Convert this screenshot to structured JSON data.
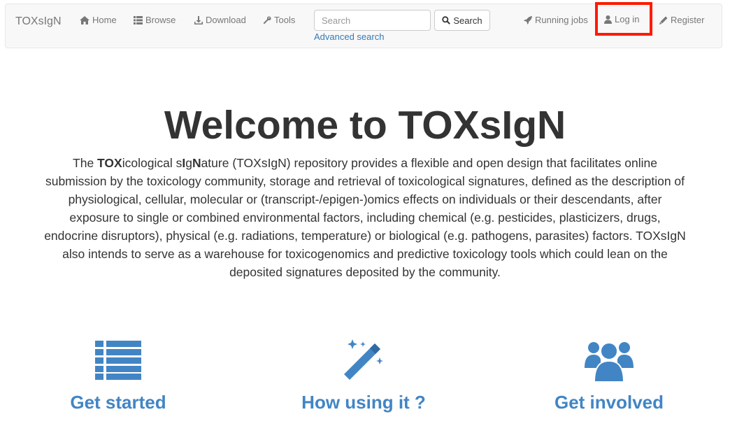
{
  "navbar": {
    "brand": "TOXsIgN",
    "home": "Home",
    "browse": "Browse",
    "download": "Download",
    "tools": "Tools",
    "search_placeholder": "Search",
    "search_button": "Search",
    "advanced_search": "Advanced search",
    "running_jobs": "Running jobs",
    "login": "Log in",
    "register": "Register",
    "highlight_color": "#ff1a00"
  },
  "hero": {
    "title": "Welcome to TOXsIgN",
    "desc_p1": "The ",
    "desc_b1": "TOX",
    "desc_p2": "icological s",
    "desc_b2": "I",
    "desc_p3": "g",
    "desc_b3": "N",
    "desc_p4": "ature (TOXsIgN) repository provides a flexible and open design that facilitates online submission by the toxicology community, storage and retrieval of toxicological signatures, defined as the description of physiological, cellular, molecular or (transcript-/epigen-)omics effects on individuals or their descendants, after exposure to single or combined environmental factors, including chemical (e.g. pesticides, plasticizers, drugs, endocrine disruptors), physical (e.g. radiations, temperature) or biological (e.g. pathogens, parasites) factors. TOXsIgN also intends to serve as a warehouse for toxicogenomics and predictive toxicology tools which could lean on the deposited signatures deposited by the community."
  },
  "features": [
    {
      "label": "Get started",
      "icon": "list-icon"
    },
    {
      "label": "How using it ?",
      "icon": "magic-wand-icon"
    },
    {
      "label": "Get involved",
      "icon": "users-icon"
    }
  ],
  "colors": {
    "accent": "#4285c4",
    "link": "#337ab7"
  }
}
